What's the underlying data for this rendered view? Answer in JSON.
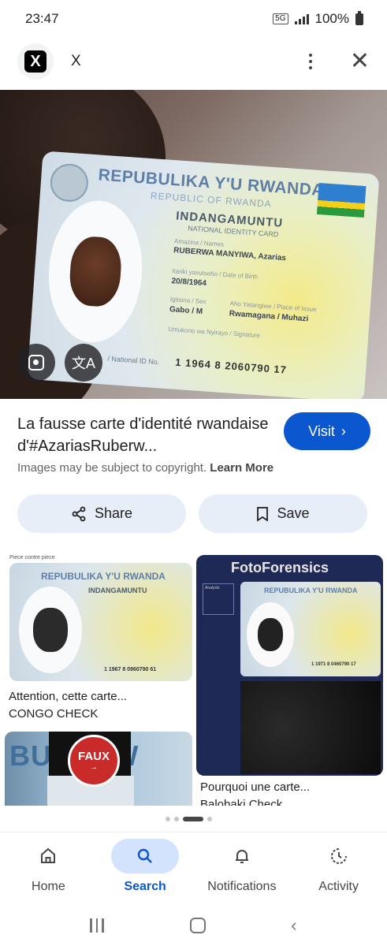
{
  "status_bar": {
    "time": "23:47",
    "network": "5G",
    "battery": "100%"
  },
  "header": {
    "source_name": "X",
    "logo_letter": "X"
  },
  "hero_image": {
    "card_title": "REPUBULIKA Y'U RWANDA",
    "card_subtitle": "REPUBLIC OF RWANDA",
    "card_type": "INDANGAMUNTU",
    "card_type_sub": "NATIONAL IDENTITY CARD",
    "name_label": "Amazina / Names",
    "name_value": "RUBERWA MANYIWA, Azarias",
    "dob_label": "Itariki yavutseho / Date of Birth",
    "dob_value": "20/8/1964",
    "sex_label": "Igitsina / Sex",
    "sex_value": "Gabo / M",
    "place_label": "Aho Yatangiwe / Place of Issue",
    "place_value": "Rwamagana / Muhazi",
    "signature_label": "Umukono wa Nyirayo / Signature",
    "id_label": "/ National ID No.",
    "id_number": "1 1964 8 2060790 17"
  },
  "result": {
    "title": "La fausse carte d'identité rwandaise d'#AzariasRuberw...",
    "visit_label": "Visit",
    "copyright_text": "Images may be subject to copyright.",
    "learn_more": "Learn More"
  },
  "actions": {
    "share_label": "Share",
    "save_label": "Save"
  },
  "related": [
    {
      "caption": "Attention, cette carte...",
      "source": "CONGO CHECK",
      "top_note": "Piece contre piece",
      "card_title": "REPUBULIKA Y'U RWANDA",
      "card_type": "INDANGAMUNTU",
      "card_number": "1 1967 8 0960790 61"
    },
    {
      "caption": "Pourquoi une carte...",
      "source": "Balobaki Check",
      "header_text": "FotoForensics",
      "card_title": "REPUBULIKA Y'U RWANDA",
      "card_number": "1 1971 8 0460790 17",
      "panel_label": "Analysis"
    },
    {
      "banner_text": "BU  U RW",
      "badge_text": "FAUX"
    }
  ],
  "bottom_nav": [
    {
      "label": "Home",
      "icon": "home-icon",
      "active": false
    },
    {
      "label": "Search",
      "icon": "search-icon",
      "active": true
    },
    {
      "label": "Notifications",
      "icon": "bell-icon",
      "active": false
    },
    {
      "label": "Activity",
      "icon": "activity-icon",
      "active": false
    }
  ],
  "colors": {
    "accent": "#0b57d0",
    "pill": "#e8eef8",
    "active_nav": "#d3e3fd",
    "faux_red": "#c92a2a"
  }
}
